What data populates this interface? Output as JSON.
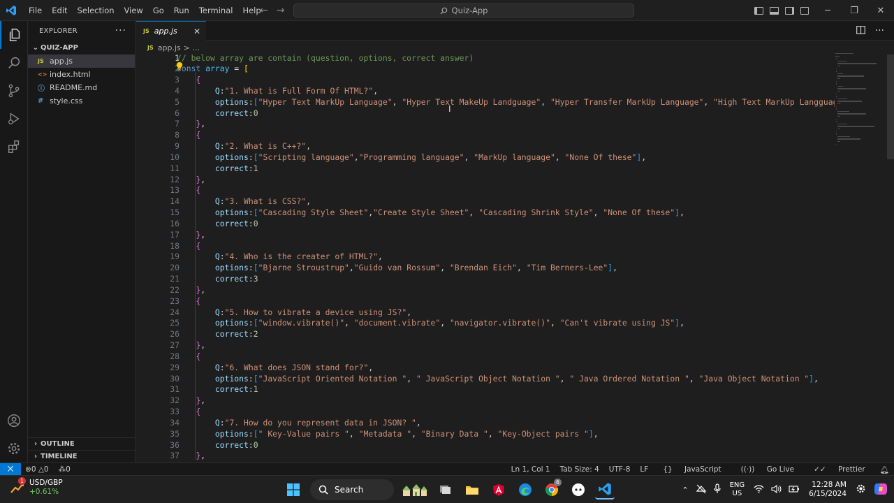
{
  "window": {
    "search_text": "Quiz-App"
  },
  "menu": [
    "File",
    "Edit",
    "Selection",
    "View",
    "Go",
    "Run",
    "Terminal",
    "Help"
  ],
  "sidebar": {
    "title": "EXPLORER",
    "folder": "QUIZ-APP",
    "files": [
      {
        "name": "app.js",
        "type": "js",
        "badge": "JS"
      },
      {
        "name": "index.html",
        "type": "html",
        "badge": "<>"
      },
      {
        "name": "README.md",
        "type": "info",
        "badge": "ⓘ"
      },
      {
        "name": "style.css",
        "type": "css",
        "badge": "#"
      }
    ],
    "outline": "OUTLINE",
    "timeline": "TIMELINE"
  },
  "editor": {
    "tab_label": "app.js",
    "tab_badge": "JS",
    "breadcrumb_file": "app.js",
    "breadcrumb_rest": "> ...",
    "lines": [
      [
        [
          "com",
          "// below array are contain (question, options, correct answer)"
        ]
      ],
      [
        [
          "kw",
          "const"
        ],
        [
          "p",
          " "
        ],
        [
          "var",
          "array"
        ],
        [
          "p",
          " = "
        ],
        [
          "b1",
          "["
        ]
      ],
      [
        [
          "p",
          "    "
        ],
        [
          "b2",
          "{"
        ]
      ],
      [
        [
          "p",
          "        "
        ],
        [
          "key",
          "Q"
        ],
        [
          "p",
          ":"
        ],
        [
          "str",
          "\"1. What is Full Form Of HTML?\""
        ],
        [
          "p",
          ","
        ]
      ],
      [
        [
          "p",
          "        "
        ],
        [
          "key",
          "options"
        ],
        [
          "p",
          ":"
        ],
        [
          "b3",
          "["
        ],
        [
          "str",
          "\"Hyper Text MarkUp Language\""
        ],
        [
          "p",
          ", "
        ],
        [
          "str",
          "\"Hyper Text MakeUp Landguage\""
        ],
        [
          "p",
          ", "
        ],
        [
          "str",
          "\"Hyper Transfer MarkUp Language\""
        ],
        [
          "p",
          ", "
        ],
        [
          "str",
          "\"High Text MarkUp Langguage\""
        ],
        [
          "b3",
          "]"
        ],
        [
          "p",
          ","
        ]
      ],
      [
        [
          "p",
          "        "
        ],
        [
          "key",
          "correct"
        ],
        [
          "p",
          ":"
        ],
        [
          "num",
          "0"
        ]
      ],
      [
        [
          "p",
          "    "
        ],
        [
          "b2",
          "}"
        ],
        [
          "p",
          ","
        ]
      ],
      [
        [
          "p",
          "    "
        ],
        [
          "b2",
          "{"
        ]
      ],
      [
        [
          "p",
          "        "
        ],
        [
          "key",
          "Q"
        ],
        [
          "p",
          ":"
        ],
        [
          "str",
          "\"2. What is C++?\""
        ],
        [
          "p",
          ","
        ]
      ],
      [
        [
          "p",
          "        "
        ],
        [
          "key",
          "options"
        ],
        [
          "p",
          ":"
        ],
        [
          "b3",
          "["
        ],
        [
          "str",
          "\"Scripting language\""
        ],
        [
          "p",
          ","
        ],
        [
          "str",
          "\"Programming language\""
        ],
        [
          "p",
          ", "
        ],
        [
          "str",
          "\"MarkUp language\""
        ],
        [
          "p",
          ", "
        ],
        [
          "str",
          "\"None Of these\""
        ],
        [
          "b3",
          "]"
        ],
        [
          "p",
          ","
        ]
      ],
      [
        [
          "p",
          "        "
        ],
        [
          "key",
          "correct"
        ],
        [
          "p",
          ":"
        ],
        [
          "num",
          "1"
        ]
      ],
      [
        [
          "p",
          "    "
        ],
        [
          "b2",
          "}"
        ],
        [
          "p",
          ","
        ]
      ],
      [
        [
          "p",
          "    "
        ],
        [
          "b2",
          "{"
        ]
      ],
      [
        [
          "p",
          "        "
        ],
        [
          "key",
          "Q"
        ],
        [
          "p",
          ":"
        ],
        [
          "str",
          "\"3. What is CSS?\""
        ],
        [
          "p",
          ","
        ]
      ],
      [
        [
          "p",
          "        "
        ],
        [
          "key",
          "options"
        ],
        [
          "p",
          ":"
        ],
        [
          "b3",
          "["
        ],
        [
          "str",
          "\"Cascading Style Sheet\""
        ],
        [
          "p",
          ","
        ],
        [
          "str",
          "\"Create Style Sheet\""
        ],
        [
          "p",
          ", "
        ],
        [
          "str",
          "\"Cascading Shrink Style\""
        ],
        [
          "p",
          ", "
        ],
        [
          "str",
          "\"None Of these\""
        ],
        [
          "b3",
          "]"
        ],
        [
          "p",
          ","
        ]
      ],
      [
        [
          "p",
          "        "
        ],
        [
          "key",
          "correct"
        ],
        [
          "p",
          ":"
        ],
        [
          "num",
          "0"
        ]
      ],
      [
        [
          "p",
          "    "
        ],
        [
          "b2",
          "}"
        ],
        [
          "p",
          ","
        ]
      ],
      [
        [
          "p",
          "    "
        ],
        [
          "b2",
          "{"
        ]
      ],
      [
        [
          "p",
          "        "
        ],
        [
          "key",
          "Q"
        ],
        [
          "p",
          ":"
        ],
        [
          "str",
          "\"4. Who is the creater of HTML?\""
        ],
        [
          "p",
          ","
        ]
      ],
      [
        [
          "p",
          "        "
        ],
        [
          "key",
          "options"
        ],
        [
          "p",
          ":"
        ],
        [
          "b3",
          "["
        ],
        [
          "str",
          "\"Bjarne Stroustrup\""
        ],
        [
          "p",
          ","
        ],
        [
          "str",
          "\"Guido van Rossum\""
        ],
        [
          "p",
          ", "
        ],
        [
          "str",
          "\"Brendan Eich\""
        ],
        [
          "p",
          ", "
        ],
        [
          "str",
          "\"Tim Berners-Lee\""
        ],
        [
          "b3",
          "]"
        ],
        [
          "p",
          ","
        ]
      ],
      [
        [
          "p",
          "        "
        ],
        [
          "key",
          "correct"
        ],
        [
          "p",
          ":"
        ],
        [
          "num",
          "3"
        ]
      ],
      [
        [
          "p",
          "    "
        ],
        [
          "b2",
          "}"
        ],
        [
          "p",
          ","
        ]
      ],
      [
        [
          "p",
          "    "
        ],
        [
          "b2",
          "{"
        ]
      ],
      [
        [
          "p",
          "        "
        ],
        [
          "key",
          "Q"
        ],
        [
          "p",
          ":"
        ],
        [
          "str",
          "\"5. How to vibrate a device using JS?\""
        ],
        [
          "p",
          ","
        ]
      ],
      [
        [
          "p",
          "        "
        ],
        [
          "key",
          "options"
        ],
        [
          "p",
          ":"
        ],
        [
          "b3",
          "["
        ],
        [
          "str",
          "\"window.vibrate()\""
        ],
        [
          "p",
          ", "
        ],
        [
          "str",
          "\"document.vibrate\""
        ],
        [
          "p",
          ", "
        ],
        [
          "str",
          "\"navigator.vibrate()\""
        ],
        [
          "p",
          ", "
        ],
        [
          "str",
          "\"Can't vibrate using JS\""
        ],
        [
          "b3",
          "]"
        ],
        [
          "p",
          ","
        ]
      ],
      [
        [
          "p",
          "        "
        ],
        [
          "key",
          "correct"
        ],
        [
          "p",
          ":"
        ],
        [
          "num",
          "2"
        ]
      ],
      [
        [
          "p",
          "    "
        ],
        [
          "b2",
          "}"
        ],
        [
          "p",
          ","
        ]
      ],
      [
        [
          "p",
          "    "
        ],
        [
          "b2",
          "{"
        ]
      ],
      [
        [
          "p",
          "        "
        ],
        [
          "key",
          "Q"
        ],
        [
          "p",
          ":"
        ],
        [
          "str",
          "\"6. What does JSON stand for?\""
        ],
        [
          "p",
          ","
        ]
      ],
      [
        [
          "p",
          "        "
        ],
        [
          "key",
          "options"
        ],
        [
          "p",
          ":"
        ],
        [
          "b3",
          "["
        ],
        [
          "str",
          "\"JavaScript Oriented Notation \""
        ],
        [
          "p",
          ", "
        ],
        [
          "str",
          "\" JavaScript Object Notation \""
        ],
        [
          "p",
          ", "
        ],
        [
          "str",
          "\" Java Ordered Notation \""
        ],
        [
          "p",
          ", "
        ],
        [
          "str",
          "\"Java Object Notation \""
        ],
        [
          "b3",
          "]"
        ],
        [
          "p",
          ","
        ]
      ],
      [
        [
          "p",
          "        "
        ],
        [
          "key",
          "correct"
        ],
        [
          "p",
          ":"
        ],
        [
          "num",
          "1"
        ]
      ],
      [
        [
          "p",
          "    "
        ],
        [
          "b2",
          "}"
        ],
        [
          "p",
          ","
        ]
      ],
      [
        [
          "p",
          "    "
        ],
        [
          "b2",
          "{"
        ]
      ],
      [
        [
          "p",
          "        "
        ],
        [
          "key",
          "Q"
        ],
        [
          "p",
          ":"
        ],
        [
          "str",
          "\"7. How do you represent data in JSON? \""
        ],
        [
          "p",
          ","
        ]
      ],
      [
        [
          "p",
          "        "
        ],
        [
          "key",
          "options"
        ],
        [
          "p",
          ":"
        ],
        [
          "b3",
          "["
        ],
        [
          "str",
          "\" Key-Value pairs \""
        ],
        [
          "p",
          ", "
        ],
        [
          "str",
          "\"Metadata \""
        ],
        [
          "p",
          ", "
        ],
        [
          "str",
          "\"Binary Data \""
        ],
        [
          "p",
          ", "
        ],
        [
          "str",
          "\"Key-Object pairs \""
        ],
        [
          "b3",
          "]"
        ],
        [
          "p",
          ","
        ]
      ],
      [
        [
          "p",
          "        "
        ],
        [
          "key",
          "correct"
        ],
        [
          "p",
          ":"
        ],
        [
          "num",
          "0"
        ]
      ],
      [
        [
          "p",
          "    "
        ],
        [
          "b2",
          "}"
        ],
        [
          "p",
          ","
        ]
      ]
    ]
  },
  "statusbar": {
    "errors": "0",
    "warnings": "0",
    "ports": "0",
    "position": "Ln 1, Col 1",
    "tab_size": "Tab Size: 4",
    "encoding": "UTF-8",
    "eol": "LF",
    "language": "JavaScript",
    "go_live": "Go Live",
    "prettier": "Prettier"
  },
  "taskbar": {
    "ticker": "USD/GBP",
    "change": "+0.61%",
    "ticker_badge": "1",
    "search_label": "Search",
    "chrome_badge": "6",
    "lang_top": "ENG",
    "lang_bottom": "US",
    "time": "12:28 AM",
    "date": "6/15/2024"
  },
  "colors": {
    "accent": "#0078d4",
    "editor_bg": "#1e1e1e",
    "sidebar_bg": "#181818"
  }
}
